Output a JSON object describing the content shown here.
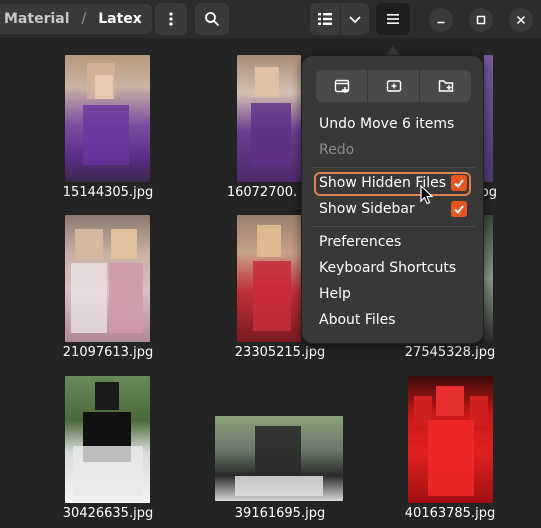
{
  "header": {
    "breadcrumb": {
      "parent": "Material",
      "separator": "/",
      "current": "Latex"
    }
  },
  "files": [
    {
      "name": "15144305.jpg"
    },
    {
      "name": "16072700."
    },
    {
      "name": "jpg"
    },
    {
      "name": "21097613.jpg"
    },
    {
      "name": "23305215.jpg"
    },
    {
      "name": "27545328.jpg"
    },
    {
      "name": "30426635.jpg"
    },
    {
      "name": "39161695.jpg"
    },
    {
      "name": "40163785.jpg"
    }
  ],
  "menu": {
    "undo": "Undo Move 6 items",
    "redo": "Redo",
    "show_hidden": "Show Hidden Files",
    "show_hidden_checked": true,
    "show_sidebar": "Show Sidebar",
    "show_sidebar_checked": true,
    "preferences": "Preferences",
    "shortcuts": "Keyboard Shortcuts",
    "help": "Help",
    "about": "About Files"
  },
  "colors": {
    "accent": "#e95420",
    "background": "#242424",
    "popover": "#383838"
  }
}
